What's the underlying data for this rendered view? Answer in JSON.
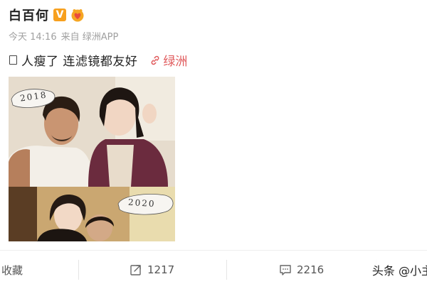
{
  "post": {
    "username": "白百何",
    "vip_badge": "V",
    "meta": {
      "time": "今天 14:16",
      "source": "来自 绿洲APP"
    },
    "text": "人瘦了 连滤镜都友好",
    "link_label": "绿洲",
    "photo_tags": {
      "top": "2018",
      "bottom": "2020"
    }
  },
  "actions": {
    "collect_label": "收藏",
    "repost_count": "1217",
    "comment_count": "2216"
  },
  "watermark": "头条 @小主",
  "colors": {
    "link": "#e0595b",
    "vip": "#f7a01e",
    "meta_text": "#a0a0a0"
  },
  "icons": {
    "vip": "vip-badge-icon",
    "level": "heart-level-icon",
    "checkbox": "checkbox-icon",
    "link": "link-icon",
    "repost": "repost-icon",
    "comment": "comment-icon"
  }
}
